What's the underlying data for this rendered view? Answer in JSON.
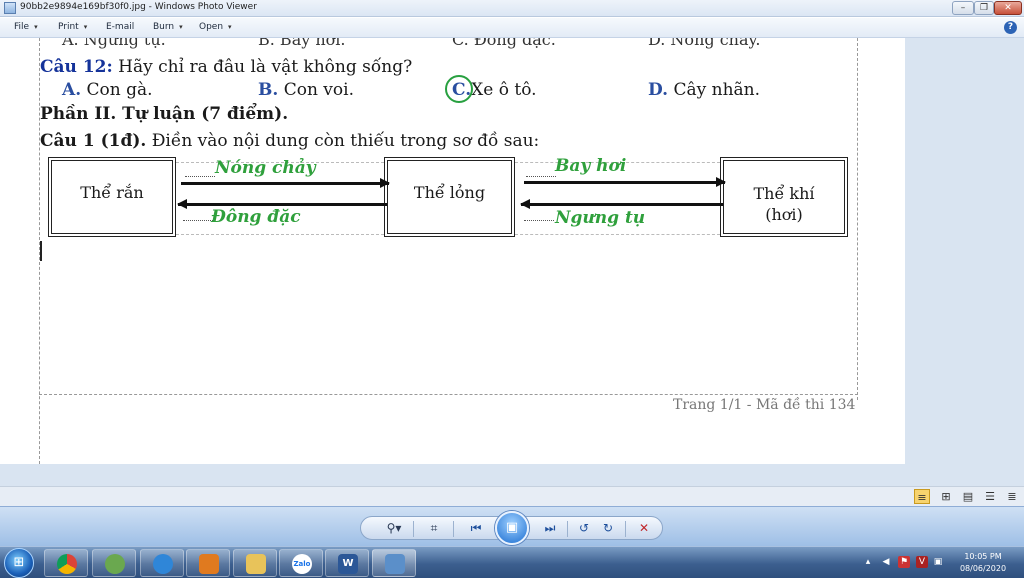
{
  "window": {
    "title": "90bb2e9894e169bf30f0.jpg - Windows Photo Viewer",
    "min": "–",
    "max": "❐",
    "close": "✕"
  },
  "menu": {
    "file": "File",
    "print": "Print",
    "email": "E-mail",
    "burn": "Burn",
    "open": "Open",
    "caret": "▾",
    "help": "?"
  },
  "document": {
    "cut_line": {
      "A": "A. Ngưng tụ.",
      "B": "B. Bay hơi.",
      "C": "C. Đông đặc.",
      "D": "D. Nóng chảy."
    },
    "q12": {
      "label": "Câu 12:",
      "text": " Hãy chỉ ra đâu là vật không sống?"
    },
    "options": [
      {
        "letter": "A.",
        "text": " Con gà."
      },
      {
        "letter": "B.",
        "text": " Con voi."
      },
      {
        "letter": "C.",
        "text": "Xe ô tô."
      },
      {
        "letter": "D.",
        "text": " Cây nhãn."
      }
    ],
    "part2": "Phần II. Tự luận (7 điểm).",
    "cau1": {
      "label": "Câu 1 (1đ).",
      "text": " Điền vào nội dung còn thiếu trong sơ đồ sau:"
    },
    "diagram": {
      "solid": "Thể rắn",
      "liquid": "Thể lỏng",
      "gas_line1": "Thể khí",
      "gas_line2": "(hơi)",
      "melting": "Nóng chảy",
      "freezing": "Đông đặc",
      "evaporation": "Bay hơi",
      "condensation": "Ngưng tụ"
    },
    "footer": "Trang 1/1 - Mã đề thi 134"
  },
  "toolbar": {
    "zoom": "⚲▾",
    "fit": "⌗",
    "prev": "⏮",
    "slideshow": "▣",
    "next": "⏭",
    "rotate_left": "↺",
    "rotate_right": "↻",
    "delete": "✕"
  },
  "taskbar": {
    "start": "⊞",
    "zalo": "Zalo",
    "word": "W",
    "clock_time": "10:05 PM",
    "clock_date": "08/06/2020"
  },
  "colors": {
    "handwriting": "#2fa03c",
    "circle": "#28a040",
    "question_number": "#15339a"
  }
}
